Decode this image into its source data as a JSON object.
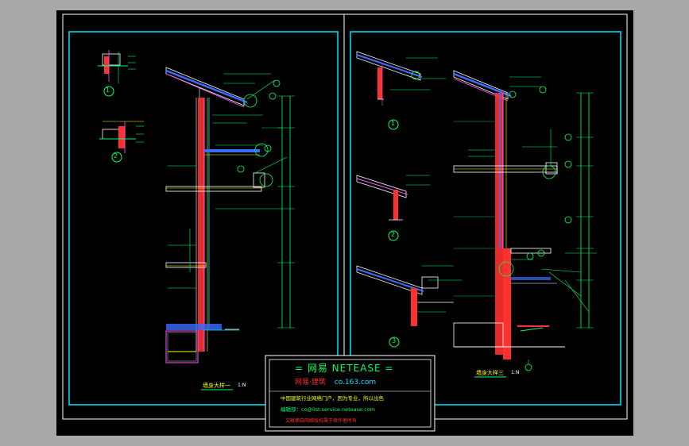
{
  "colors": {
    "background_outer": "#a8a8a8",
    "viewport": "#000000",
    "frame": "#ffffff",
    "border": "#00e5ff",
    "dim": "#00ff66",
    "wall": "#ff3030",
    "insulation": "#ff55ff",
    "cover": "#ffff00",
    "glazing": "#3c6cff"
  },
  "detail_labels": [
    "1",
    "2",
    "1",
    "2",
    "3"
  ],
  "sheet_titles": [
    "墙身大样一",
    "墙身大样三"
  ],
  "scale_note": "1:N",
  "title_block": {
    "line1": "=  网易  NETEASE  =",
    "line2_prefix": "网易·建筑",
    "line2_domain": "co.163.com",
    "line3": "中国建筑行业网络门户，因为专业，所以出色",
    "line4": "编辑部：co@list.service.netease.com",
    "line5": "文献摘自网络版权属于原作者所有"
  }
}
